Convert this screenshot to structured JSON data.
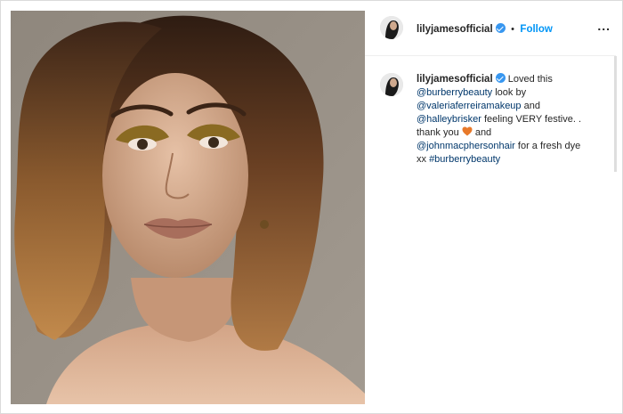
{
  "post": {
    "username": "lilyjamesofficial",
    "follow_label": "Follow",
    "separator": "•",
    "more_label": "...",
    "caption": {
      "username": "lilyjamesofficial",
      "text1": " Loved this",
      "mention1": "@burberrybeauty",
      "text2": " look by",
      "mention2": "@valeriaferreiramakeup",
      "text3": " and",
      "mention3": "@halleybrisker",
      "text4": " feeling VERY festive. .",
      "text5": "thank you ",
      "text6": " and",
      "mention4": "@johnmacphersonhair",
      "text7": " for a fresh dye",
      "text8": "xx ",
      "hashtag": "#burberrybeauty"
    }
  },
  "icons": {
    "verified": "verified-badge-icon",
    "heart": "orange-heart-emoji-icon",
    "more": "more-options-icon"
  },
  "colors": {
    "link": "#00376b",
    "follow": "#0095f6",
    "verified": "#3897f0",
    "heart": "#e8792a"
  }
}
